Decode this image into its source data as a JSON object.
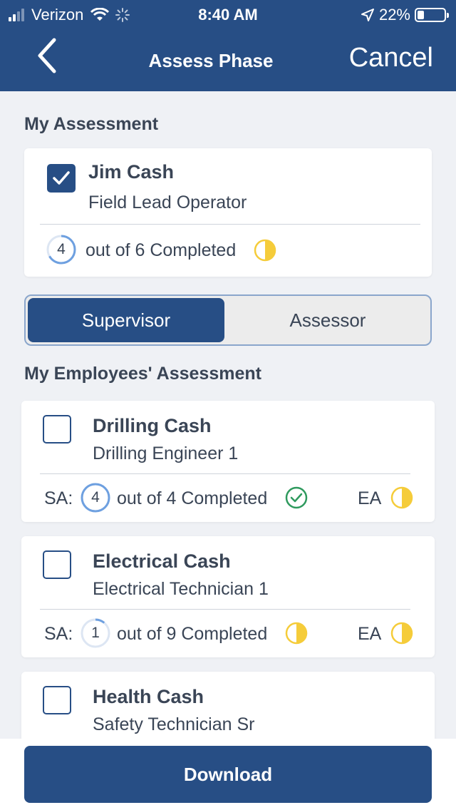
{
  "status_bar": {
    "carrier": "Verizon",
    "time": "8:40 AM",
    "battery": "22%"
  },
  "nav": {
    "title": "Assess Phase",
    "cancel_label": "Cancel",
    "back_icon": "chevron-left-icon"
  },
  "my_assessment": {
    "title": "My Assessment",
    "name": "Jim Cash",
    "role": "Field Lead Operator",
    "checked": true,
    "count": "4",
    "completed_text": "out of 6 Completed",
    "total": 6,
    "status": "half-circle-icon"
  },
  "toggle": {
    "supervisor_label": "Supervisor",
    "assessor_label": "Assessor",
    "selected": "Supervisor"
  },
  "employees": {
    "title": "My Employees' Assessment",
    "items": [
      {
        "name": "Drilling Cash",
        "role": "Drilling Engineer 1",
        "sa_label": "SA:",
        "count": "4",
        "completed_text": "out of 4 Completed",
        "total": 4,
        "sa_status": "check-circle-icon",
        "ea_label": "EA",
        "ea_status": "half-circle-icon"
      },
      {
        "name": "Electrical Cash",
        "role": "Electrical Technician 1",
        "sa_label": "SA:",
        "count": "1",
        "completed_text": "out of 9 Completed",
        "total": 9,
        "sa_status": "half-circle-icon",
        "ea_label": "EA",
        "ea_status": "half-circle-icon"
      },
      {
        "name": "Health Cash",
        "role": "Safety Technician Sr"
      }
    ]
  },
  "footer": {
    "download_label": "Download"
  },
  "colors": {
    "primary": "#274e85",
    "progress_ring": "#6ea0e0",
    "half_circle": "#f5cc3a",
    "check": "#2f9a5e"
  }
}
